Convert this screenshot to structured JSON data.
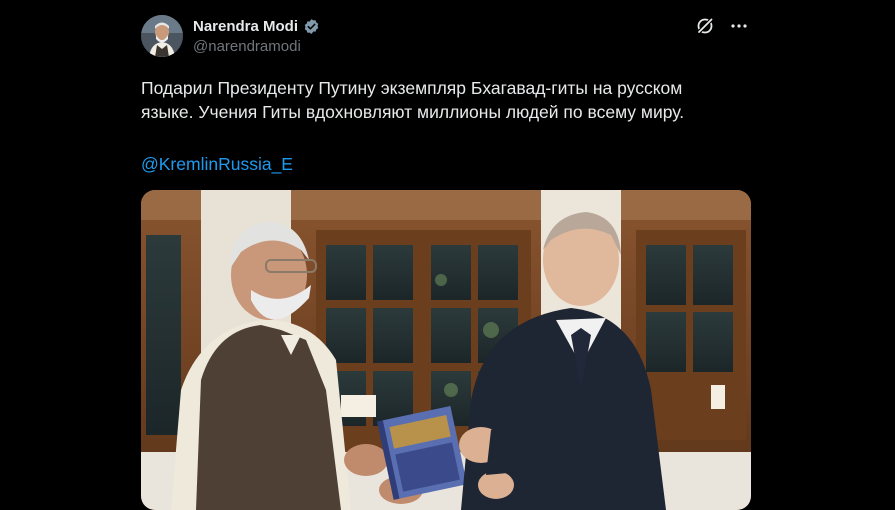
{
  "author": {
    "display_name": "Narendra Modi",
    "handle": "@narendramodi",
    "verified_icon": "verified-badge-icon",
    "avatar_icon": "avatar-photo"
  },
  "actions": {
    "grok_icon": "grok-icon",
    "more_icon": "more-icon"
  },
  "tweet": {
    "text": "Подарил Президенту Путину экземпляр Бхагавад-гиты на русском\nязыке. Учения Гиты вдохновляют миллионы людей по всему миру.",
    "mention": "@KremlinRussia_E"
  },
  "media": {
    "type": "photo",
    "photo_icon": "photo"
  },
  "colors": {
    "background": "#000000",
    "text": "#e7e9ea",
    "secondary_text": "#71767b",
    "link": "#1d9bf0",
    "verified": "#829aab"
  }
}
